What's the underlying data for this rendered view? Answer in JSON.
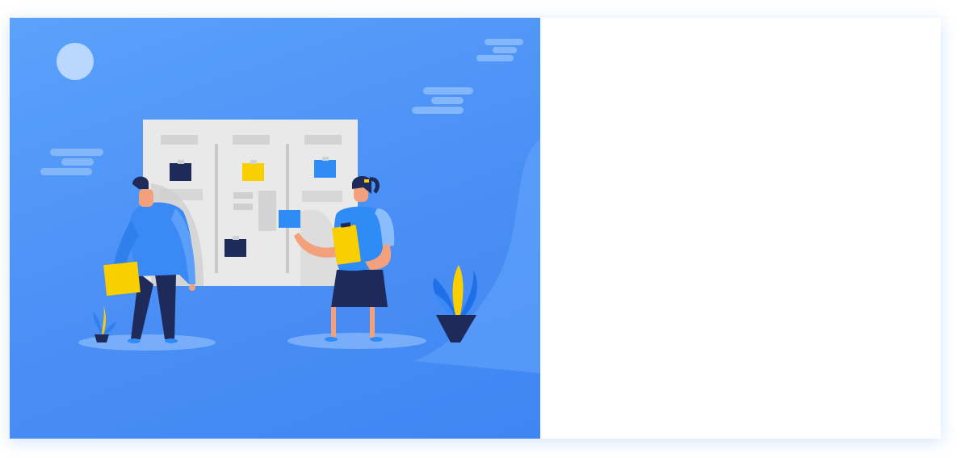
{
  "hero": {
    "illustration": "kanban-board-team-illustration",
    "colors": {
      "background_start": "#5aa2fb",
      "background_end": "#3f86f3",
      "board": "#e9e9e9",
      "navy": "#1e2a5a",
      "yellow": "#f9cf00",
      "accent_blue": "#2f8cf7"
    }
  },
  "panel": {
    "background": "#ffffff"
  }
}
